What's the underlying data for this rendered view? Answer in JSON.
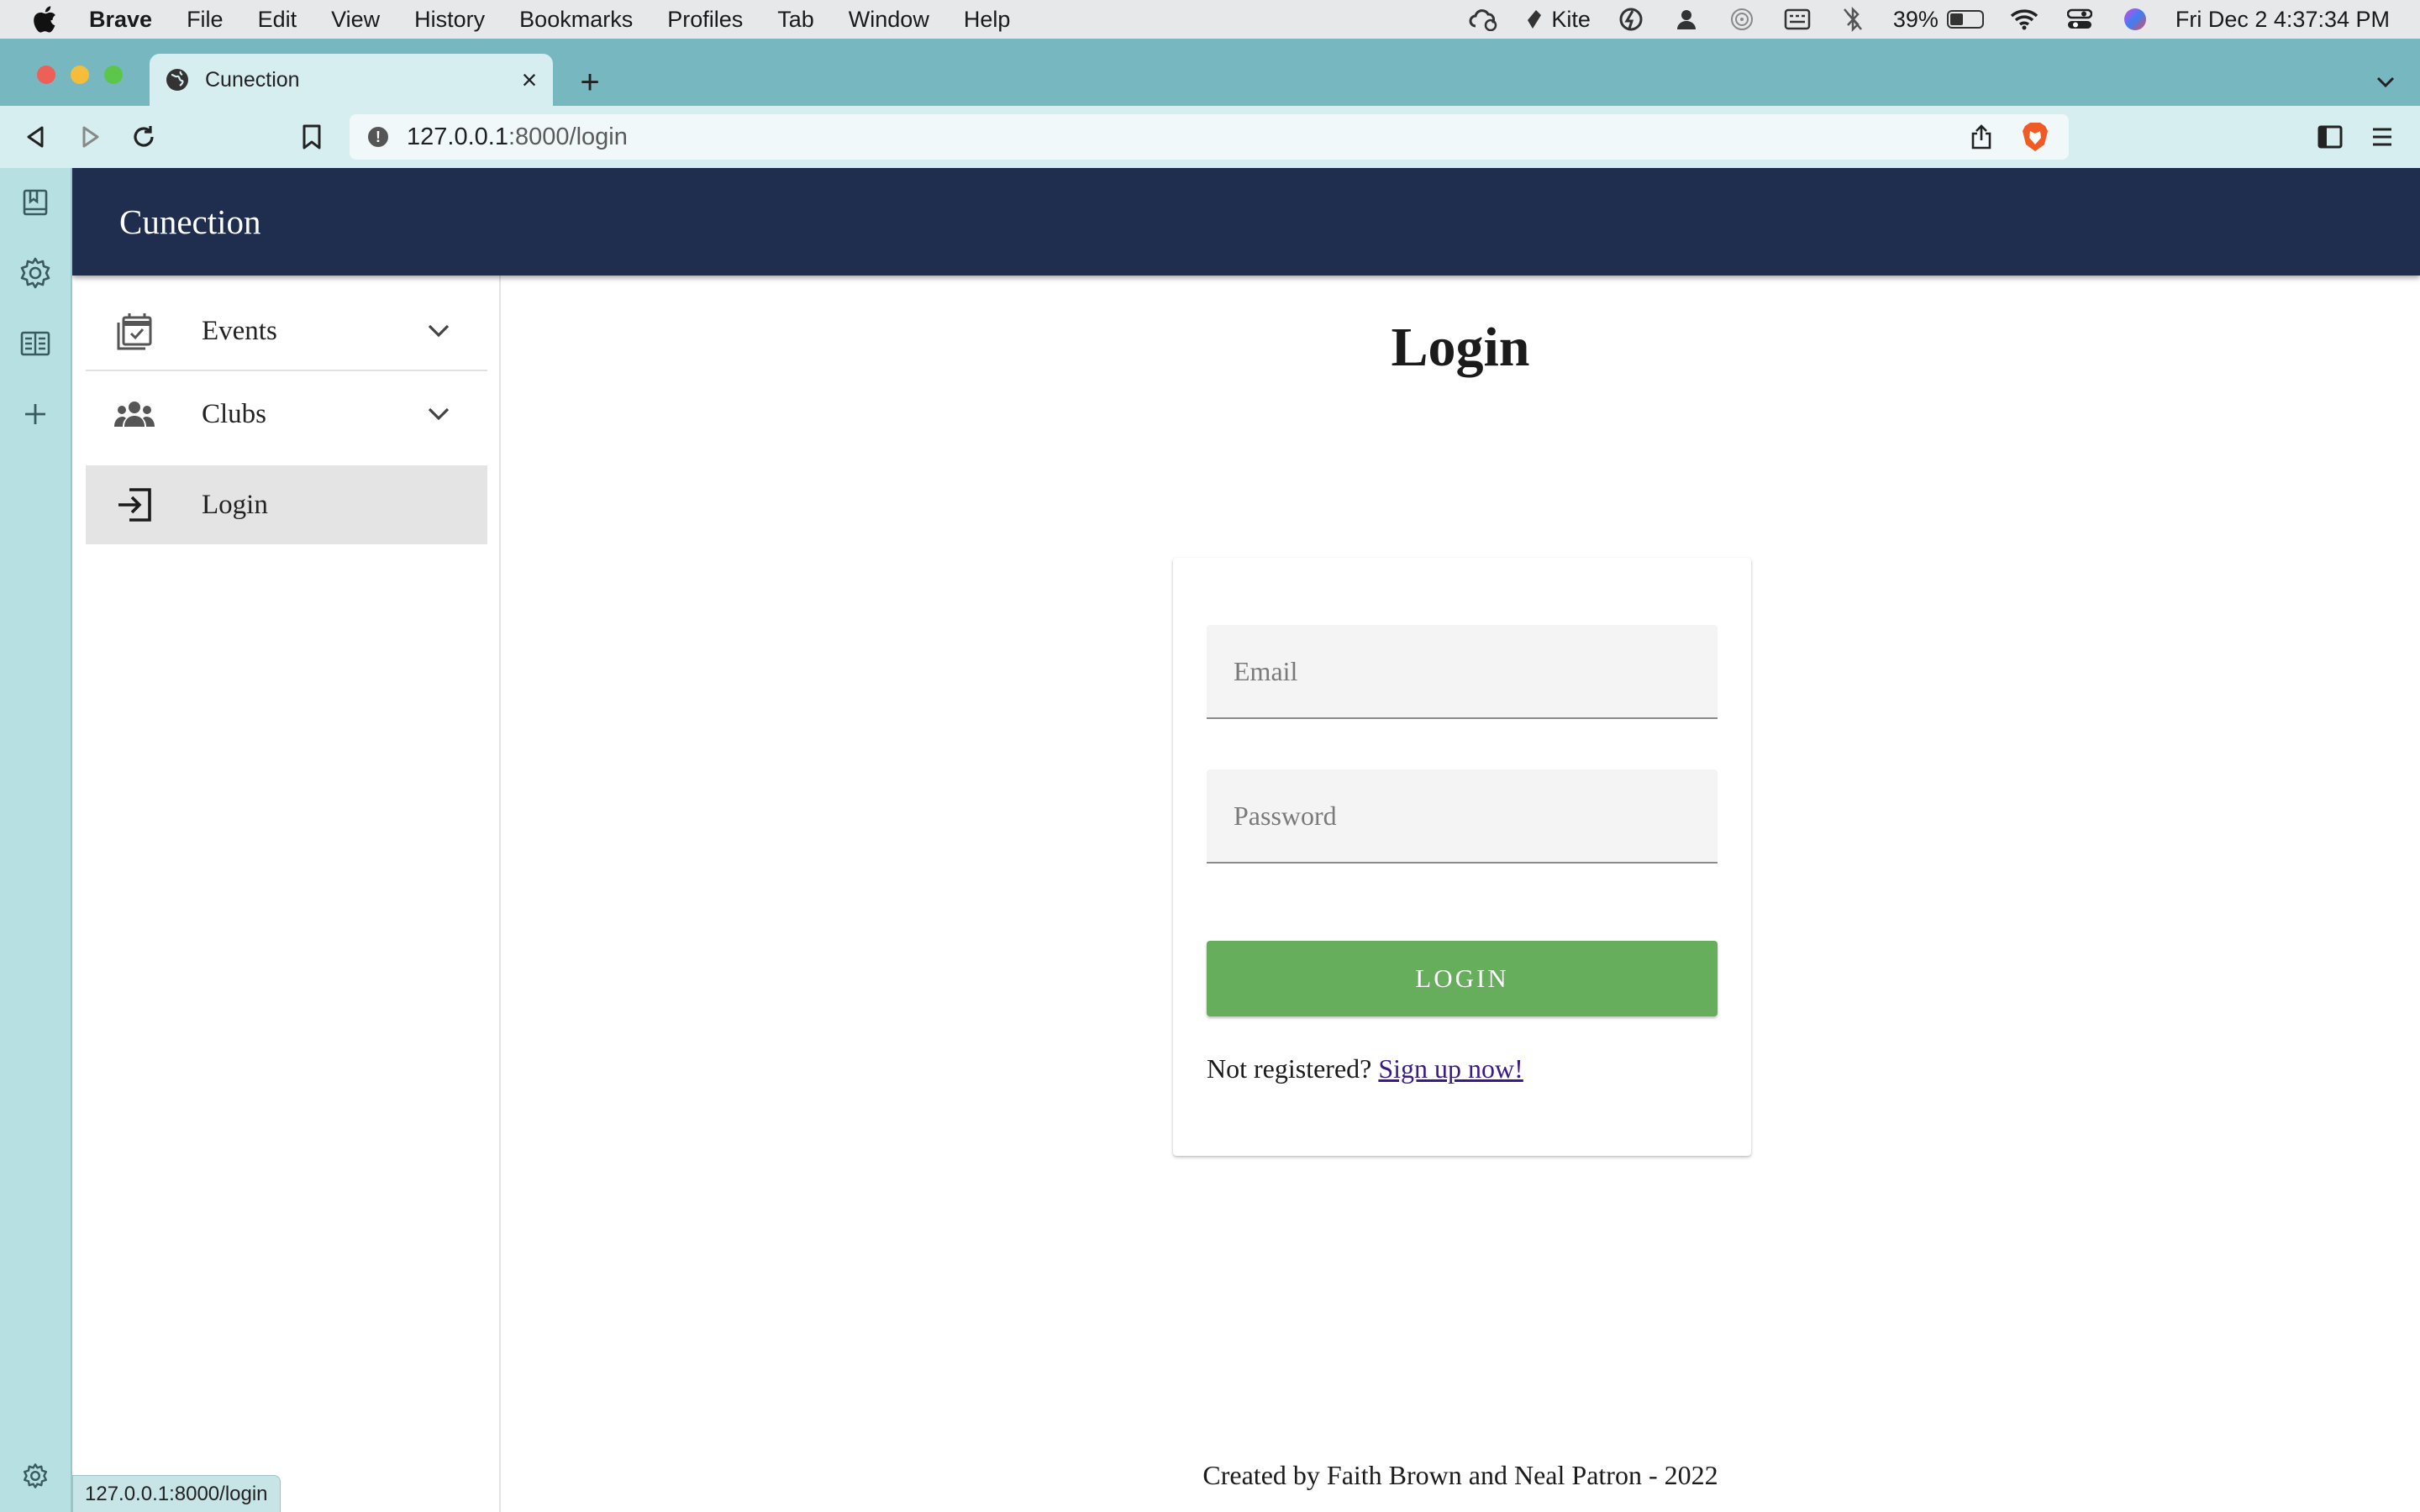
{
  "menubar": {
    "app": "Brave",
    "items": [
      "File",
      "Edit",
      "View",
      "History",
      "Bookmarks",
      "Profiles",
      "Tab",
      "Window",
      "Help"
    ],
    "status": {
      "kite": "Kite",
      "battery_percent": "39%",
      "battery_level": 0.39,
      "datetime": "Fri Dec 2  4:37:34 PM"
    }
  },
  "browser": {
    "tab_title": "Cunection",
    "tab_close": "×",
    "new_tab": "+",
    "url_host": "127.0.0.1",
    "url_rest": ":8000/login",
    "hover_link": "127.0.0.1:8000/login"
  },
  "app": {
    "brand": "Cunection",
    "nav": [
      {
        "label": "Events",
        "icon": "calendar-check-icon",
        "expandable": true
      },
      {
        "label": "Clubs",
        "icon": "group-icon",
        "expandable": true
      },
      {
        "label": "Login",
        "icon": "login-icon",
        "active": true
      }
    ]
  },
  "login": {
    "title": "Login",
    "email_placeholder": "Email",
    "password_placeholder": "Password",
    "button": "LOGIN",
    "register_prompt": "Not registered?",
    "register_link": "Sign up now!"
  },
  "footer": {
    "text": "Created by Faith Brown and Neal Patron - 2022"
  },
  "colors": {
    "navbar": "#1f2d4f",
    "button": "#66ad5c",
    "tabstrip": "#77b8c0",
    "toolbar": "#d7eef0"
  }
}
